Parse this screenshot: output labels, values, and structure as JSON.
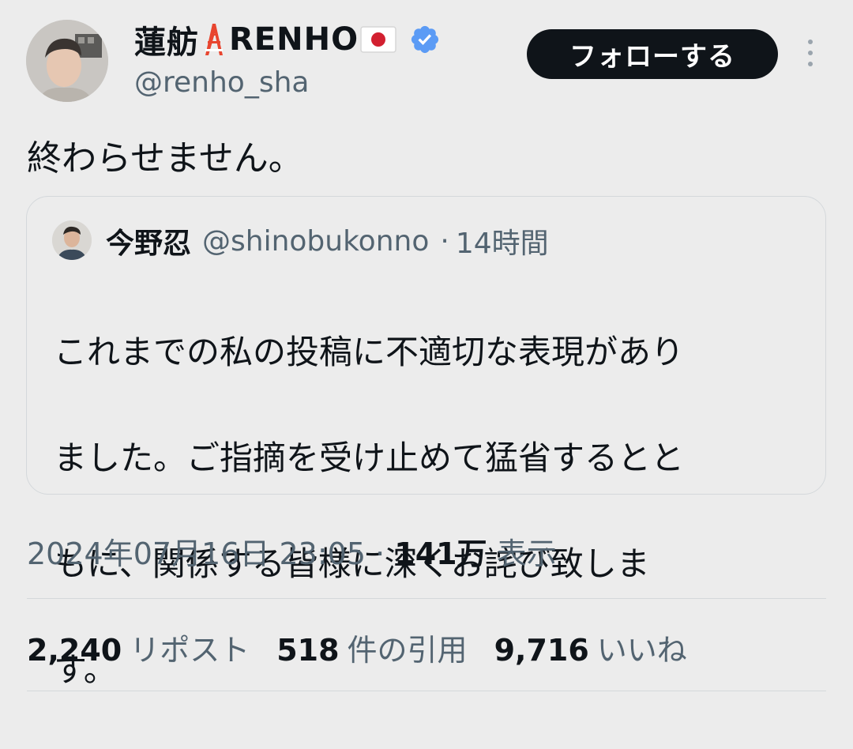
{
  "author": {
    "display_name": "蓮舫",
    "display_name_suffix": "RENHO",
    "handle": "@renho_sha",
    "emojis": [
      "tokyo-tower",
      "japan-flag"
    ],
    "verified": true,
    "verified_color": "#5b9bf5"
  },
  "follow_button": {
    "label": "フォローする"
  },
  "tweet": {
    "text": "終わらせません。"
  },
  "quoted": {
    "name": "今野忍",
    "handle": "@shinobukonno",
    "separator": "·",
    "time": "14時間",
    "text": "これまでの私の投稿に不適切な表現がありました。ご指摘を受け止めて猛省するとともに、関係する皆様に深くお詫び致します。",
    "lines": [
      "これまでの私の投稿に不適切な表現があり",
      "ました。ご指摘を受け止めて猛省するとと",
      "もに、関係する皆様に深くお詫び致しま",
      "す。"
    ]
  },
  "meta": {
    "timestamp": "2024年07月16日 23:05",
    "separator": "·",
    "views_count": "141万",
    "views_label": "表示"
  },
  "stats": [
    {
      "count": "2,240",
      "label": "リポスト"
    },
    {
      "count": "518",
      "label": "件の引用"
    },
    {
      "count": "9,716",
      "label": "いいね"
    }
  ],
  "colors": {
    "background": "#ececec",
    "text": "#0f1419",
    "muted": "#536471",
    "button": "#0f1419"
  }
}
